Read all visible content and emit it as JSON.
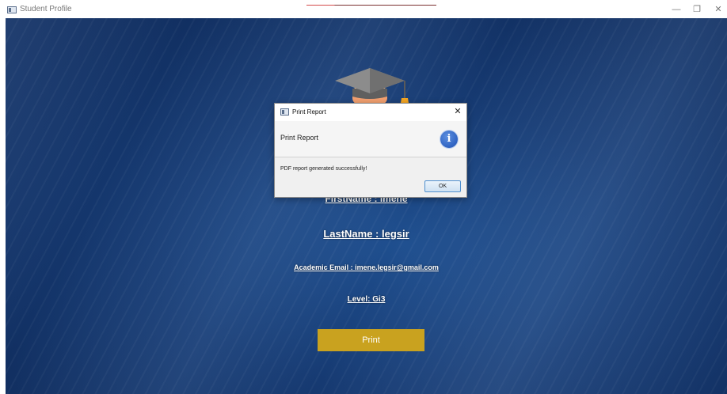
{
  "window": {
    "title": "Student Profile",
    "minimize_glyph": "—",
    "restore_glyph": "❐",
    "close_glyph": "✕"
  },
  "profile": {
    "first_name_label": "FirstName : imene",
    "last_name_label": "LastName :  legsir",
    "email_label": "Academic Email : imene.legsir@gmail.com",
    "level_label": "Level: Gi3",
    "print_button": "Print"
  },
  "dialog": {
    "title": "Print Report",
    "heading": "Print Report",
    "info_glyph": "i",
    "message": "PDF report generated successfully!",
    "ok_button": "OK",
    "close_glyph": "✕"
  },
  "colors": {
    "background": "#163a72",
    "print_button": "#c9a21f",
    "info_icon": "#2f63c2"
  }
}
